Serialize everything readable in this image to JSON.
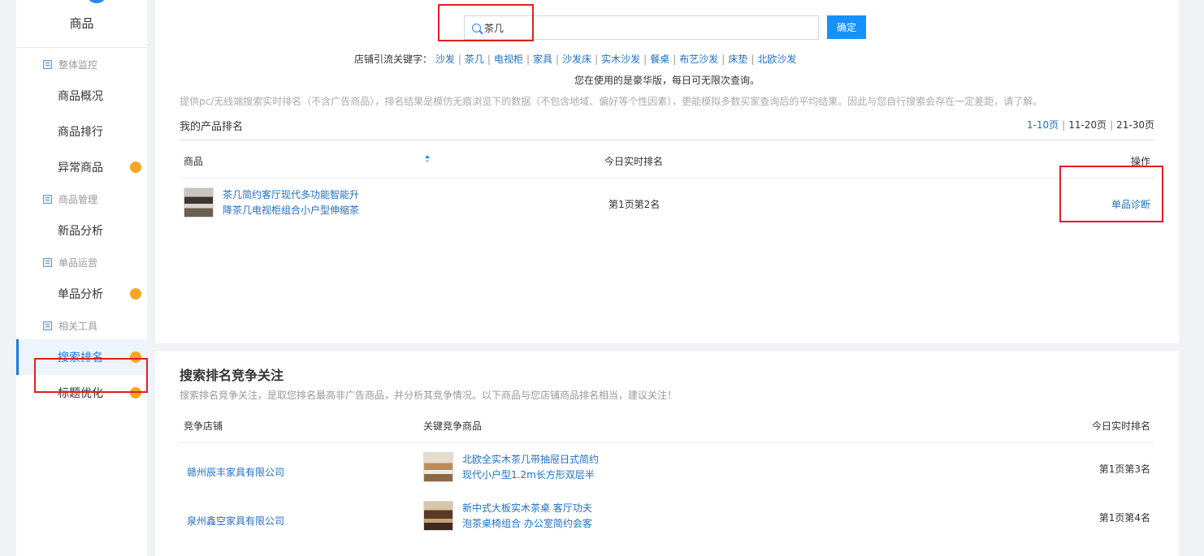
{
  "sidebar": {
    "title": "商品",
    "nav": [
      {
        "type": "section",
        "label": "整体监控",
        "icon": "building-icon"
      },
      {
        "type": "item",
        "label": "商品概况",
        "dot": false,
        "active": false
      },
      {
        "type": "item",
        "label": "商品排行",
        "dot": false,
        "active": false
      },
      {
        "type": "item",
        "label": "异常商品",
        "dot": true,
        "active": false
      },
      {
        "type": "section",
        "label": "商品管理",
        "icon": "building-icon"
      },
      {
        "type": "item",
        "label": "新品分析",
        "dot": false,
        "active": false
      },
      {
        "type": "section",
        "label": "单品运营",
        "icon": "building-icon"
      },
      {
        "type": "item",
        "label": "单品分析",
        "dot": true,
        "active": false
      },
      {
        "type": "section",
        "label": "相关工具",
        "icon": "building-icon"
      },
      {
        "type": "item",
        "label": "搜索排名",
        "dot": true,
        "active": true
      },
      {
        "type": "item",
        "label": "标题优化",
        "dot": true,
        "active": false
      }
    ]
  },
  "search": {
    "value": "茶几",
    "confirm_label": "确定"
  },
  "keywords": {
    "prefix": "店铺引流关键字：",
    "items": [
      "沙发",
      "茶几",
      "电视柜",
      "家具",
      "沙发床",
      "实木沙发",
      "餐桌",
      "布艺沙发",
      "床垫",
      "北欧沙发"
    ]
  },
  "version_note": "您在使用的是豪华版，每日可无限次查询。",
  "desc_note": "提供pc/无线端搜索实时排名（不含广告商品），排名结果是模仿无痕浏览下的数据（不包含地域、偏好等个性因素），更能模拟多数买家查询后的平均结果。因此与您自行搜索会存在一定差距，请了解。",
  "my_rank": {
    "title": "我的产品排名",
    "pager": [
      "1-10页",
      "11-20页",
      "21-30页"
    ],
    "headers": {
      "product": "商品",
      "today_rank": "今日实时排名",
      "action": "操作"
    },
    "rows": [
      {
        "title_line1": "茶几简约客厅现代多功能智能升",
        "title_line2": "降茶几电视柜组合小户型伸缩茶",
        "rank": "第1页第2名",
        "action": "单品诊断"
      }
    ]
  },
  "competition": {
    "title": "搜索排名竞争关注",
    "desc": "搜索排名竞争关注，是取您排名最高非广告商品，并分析其竞争情况。以下商品与您店铺商品排名相当，建议关注！",
    "headers": {
      "store": "竞争店铺",
      "product": "关键竞争商品",
      "today_rank": "今日实时排名"
    },
    "rows": [
      {
        "store": "赣州辰丰家具有限公司",
        "title_line1": "北欧全实木茶几带抽屉日式简约",
        "title_line2": "现代小户型1.2m长方形双层半",
        "rank": "第1页第3名"
      },
      {
        "store": "泉州鑫空家具有限公司",
        "title_line1": "新中式大板实木茶桌 客厅功夫",
        "title_line2": "泡茶桌椅组合 办公室简约会客",
        "rank": "第1页第4名"
      }
    ]
  },
  "colors": {
    "accent": "#1890ff",
    "link": "#1f6fc5",
    "badge": "#f5a623",
    "highlight": "#e02020"
  }
}
